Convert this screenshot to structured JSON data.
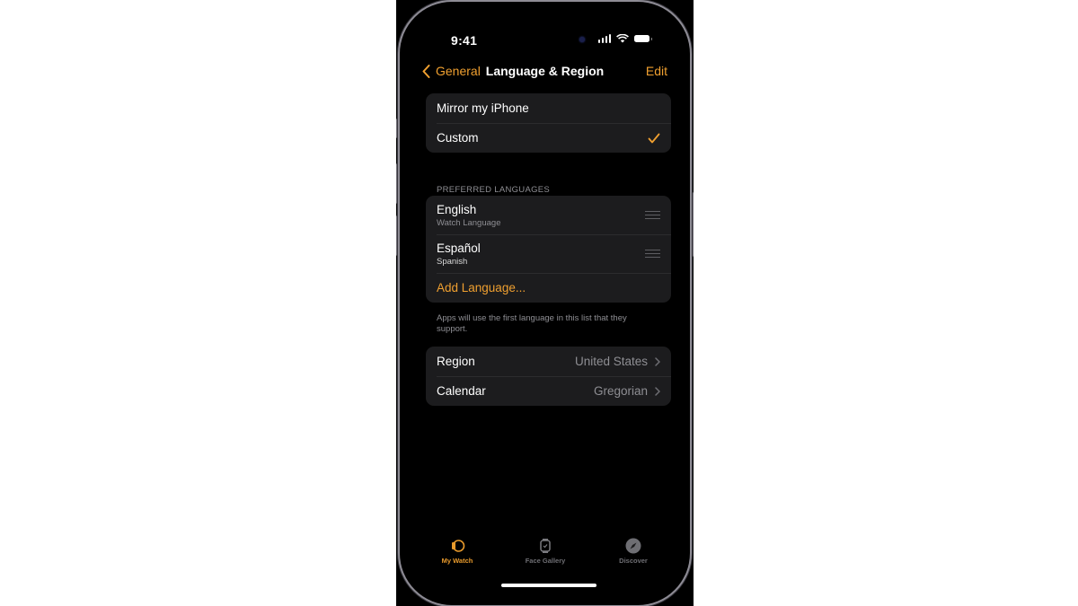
{
  "status_bar": {
    "time": "9:41",
    "icons": [
      "cellular-signal-icon",
      "wifi-icon",
      "battery-icon"
    ]
  },
  "nav": {
    "back_label": "General",
    "back_icon": "chevron-left-icon",
    "title": "Language & Region",
    "edit_label": "Edit"
  },
  "language_mode": {
    "options": [
      {
        "label": "Mirror my iPhone",
        "selected": false
      },
      {
        "label": "Custom",
        "selected": true
      }
    ],
    "selected_icon": "checkmark-icon"
  },
  "preferred_languages": {
    "header": "PREFERRED LANGUAGES",
    "items": [
      {
        "name": "English",
        "detail": "Watch Language",
        "handle_icon": "reorder-handle-icon"
      },
      {
        "name": "Español",
        "detail": "Spanish",
        "handle_icon": "reorder-handle-icon"
      }
    ],
    "add_label": "Add Language...",
    "footnote": "Apps will use the first language in this list that they support."
  },
  "settings": {
    "rows": [
      {
        "label": "Region",
        "value": "United States"
      },
      {
        "label": "Calendar",
        "value": "Gregorian"
      }
    ]
  },
  "tab_bar": {
    "tabs": [
      {
        "label": "My Watch",
        "icon": "watch-side-icon",
        "active": true
      },
      {
        "label": "Face Gallery",
        "icon": "watch-face-icon",
        "active": false
      },
      {
        "label": "Discover",
        "icon": "compass-icon",
        "active": false
      }
    ]
  },
  "colors": {
    "accent": "#f0a030",
    "background": "#000000",
    "group_background": "#1c1c1e",
    "secondary_text": "#8e8e93"
  }
}
